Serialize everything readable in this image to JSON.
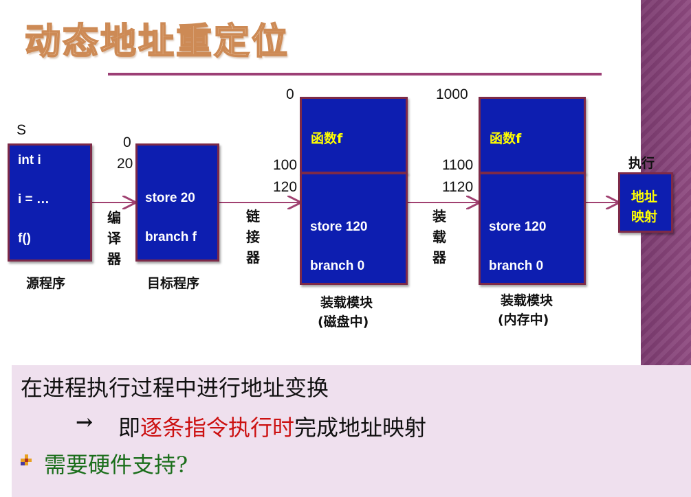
{
  "title": "动态地址重定位",
  "source_program": {
    "label_top": "S",
    "lines": [
      "int  i",
      "i = …",
      "f()"
    ],
    "caption": "源程序"
  },
  "compiler_label": [
    "编",
    "译",
    "器"
  ],
  "target_program": {
    "addr_0": "0",
    "addr_20": "20",
    "lines": [
      "store 20",
      "branch f"
    ],
    "caption": "目标程序"
  },
  "linker_label": [
    "链",
    "接",
    "器"
  ],
  "load_module_disk": {
    "addr_top": "0",
    "addr_mid1": "100",
    "addr_mid2": "120",
    "func": "函数f",
    "lines": [
      "store 120",
      "branch 0"
    ],
    "caption": [
      "装载模块",
      "(磁盘中)"
    ]
  },
  "loader_label": [
    "装",
    "载",
    "器"
  ],
  "load_module_mem": {
    "addr_top": "1000",
    "addr_mid1": "1100",
    "addr_mid2": "1120",
    "func": "函数f",
    "lines": [
      "store 120",
      "branch 0"
    ],
    "caption": [
      "装载模块",
      "(内存中)"
    ]
  },
  "execute": {
    "label": "执行",
    "box_lines": [
      "地址",
      "映射"
    ]
  },
  "bottom": {
    "line1": "在进程执行过程中进行地址变换",
    "arrow": "→",
    "line2_prefix": "即",
    "line2_highlight": "逐条指令执行时",
    "line2_suffix": "完成地址映射",
    "line3": "需要硬件支持?"
  },
  "colors": {
    "box_fill": "#0d1eb0",
    "box_border": "#7d2a48",
    "arrow": "#a04070",
    "highlight": "#cc1111",
    "green": "#1b6e1b"
  }
}
